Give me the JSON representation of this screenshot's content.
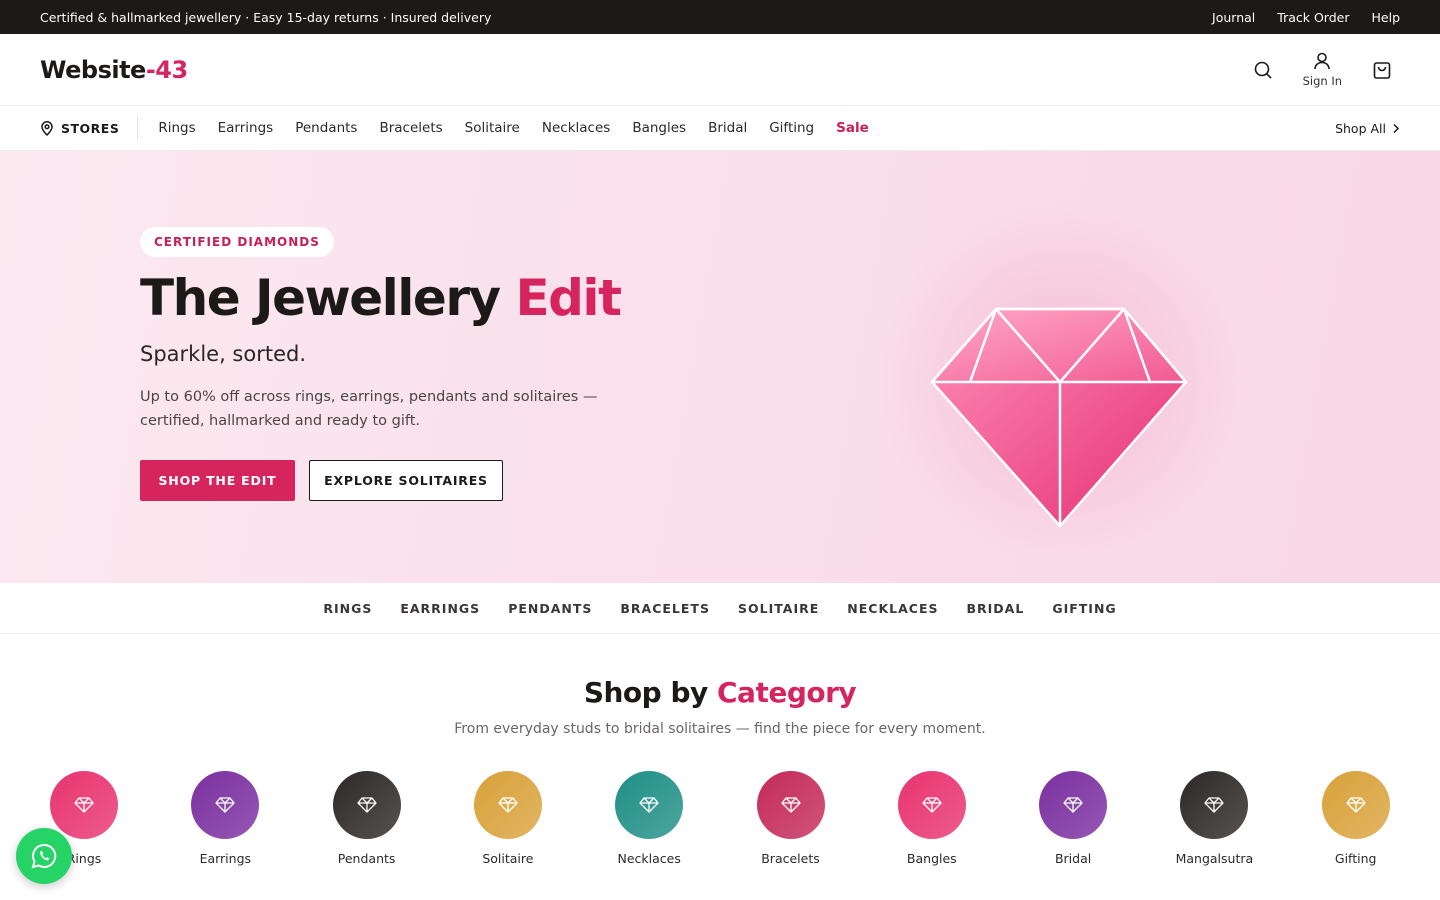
{
  "topbar": {
    "announcement": "Certified & hallmarked jewellery · Easy 15-day returns · Insured delivery",
    "links": [
      "Journal",
      "Track Order",
      "Help"
    ]
  },
  "header": {
    "logo_main": "Website",
    "logo_accent": "-43",
    "sign_in": "Sign In",
    "icons": [
      "search-icon",
      "user-icon",
      "bag-icon"
    ]
  },
  "nav": {
    "stores": "STORES",
    "items": [
      "Rings",
      "Earrings",
      "Pendants",
      "Bracelets",
      "Solitaire",
      "Necklaces",
      "Bangles",
      "Bridal",
      "Gifting"
    ],
    "sale": "Sale",
    "shop_all": "Shop All"
  },
  "hero": {
    "badge": "CERTIFIED DIAMONDS",
    "title_main": "The Jewellery ",
    "title_accent": "Edit",
    "subtitle": "Sparkle, sorted.",
    "description": "Up to 60% off across rings, earrings, pendants and solitaires — certified, hallmarked and ready to gift.",
    "primary_cta": "SHOP THE EDIT",
    "secondary_cta": "EXPLORE SOLITAIRES"
  },
  "category_strip": [
    "RINGS",
    "EARRINGS",
    "PENDANTS",
    "BRACELETS",
    "SOLITAIRE",
    "NECKLACES",
    "BRIDAL",
    "GIFTING"
  ],
  "shop_by_category": {
    "title_main": "Shop by ",
    "title_accent": "Category",
    "subtitle": "From everyday studs to bridal solitaires — find the piece for every moment.",
    "items": [
      {
        "label": "Rings",
        "color": "#e8336f"
      },
      {
        "label": "Earrings",
        "color": "#7b2fa0"
      },
      {
        "label": "Pendants",
        "color": "#2b2826"
      },
      {
        "label": "Solitaire",
        "color": "#d9a23a"
      },
      {
        "label": "Necklaces",
        "color": "#1f8f86"
      },
      {
        "label": "Bracelets",
        "color": "#c42a5a"
      },
      {
        "label": "Bangles",
        "color": "#e8336f"
      },
      {
        "label": "Bridal",
        "color": "#7b2fa0"
      },
      {
        "label": "Mangalsutra",
        "color": "#2b2826"
      },
      {
        "label": "Gifting",
        "color": "#d9a23a"
      }
    ]
  },
  "colors": {
    "accent": "#d6245f",
    "dark": "#1c1917",
    "whatsapp": "#25d366"
  }
}
